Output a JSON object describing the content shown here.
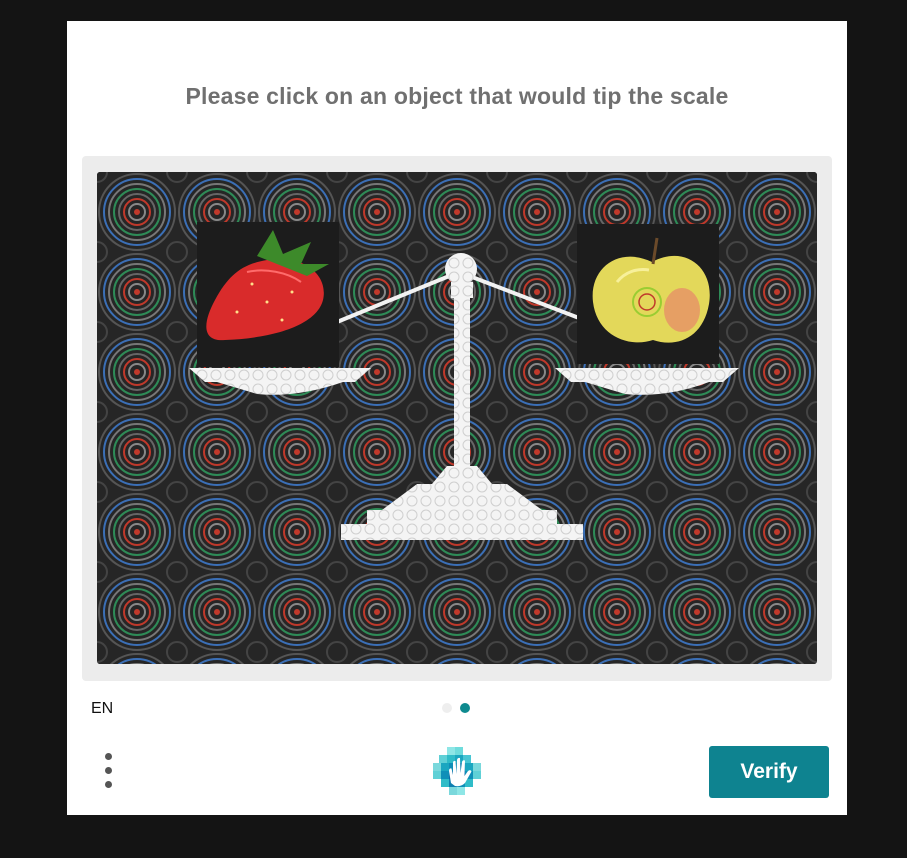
{
  "prompt": "Please click on an object that would tip the scale",
  "image": {
    "description_objects": [
      "strawberry",
      "apple",
      "balance-scale"
    ],
    "pattern_colors": [
      "#c0392b",
      "#2e8b57",
      "#3b6fb6",
      "#8a8a8a"
    ]
  },
  "footer": {
    "language": "EN",
    "pagination": {
      "total": 2,
      "current": 2
    },
    "verify_label": "Verify"
  },
  "colors": {
    "accent": "#0e8390",
    "background": "#141414",
    "card": "#ffffff",
    "prompt_text": "#707070"
  }
}
